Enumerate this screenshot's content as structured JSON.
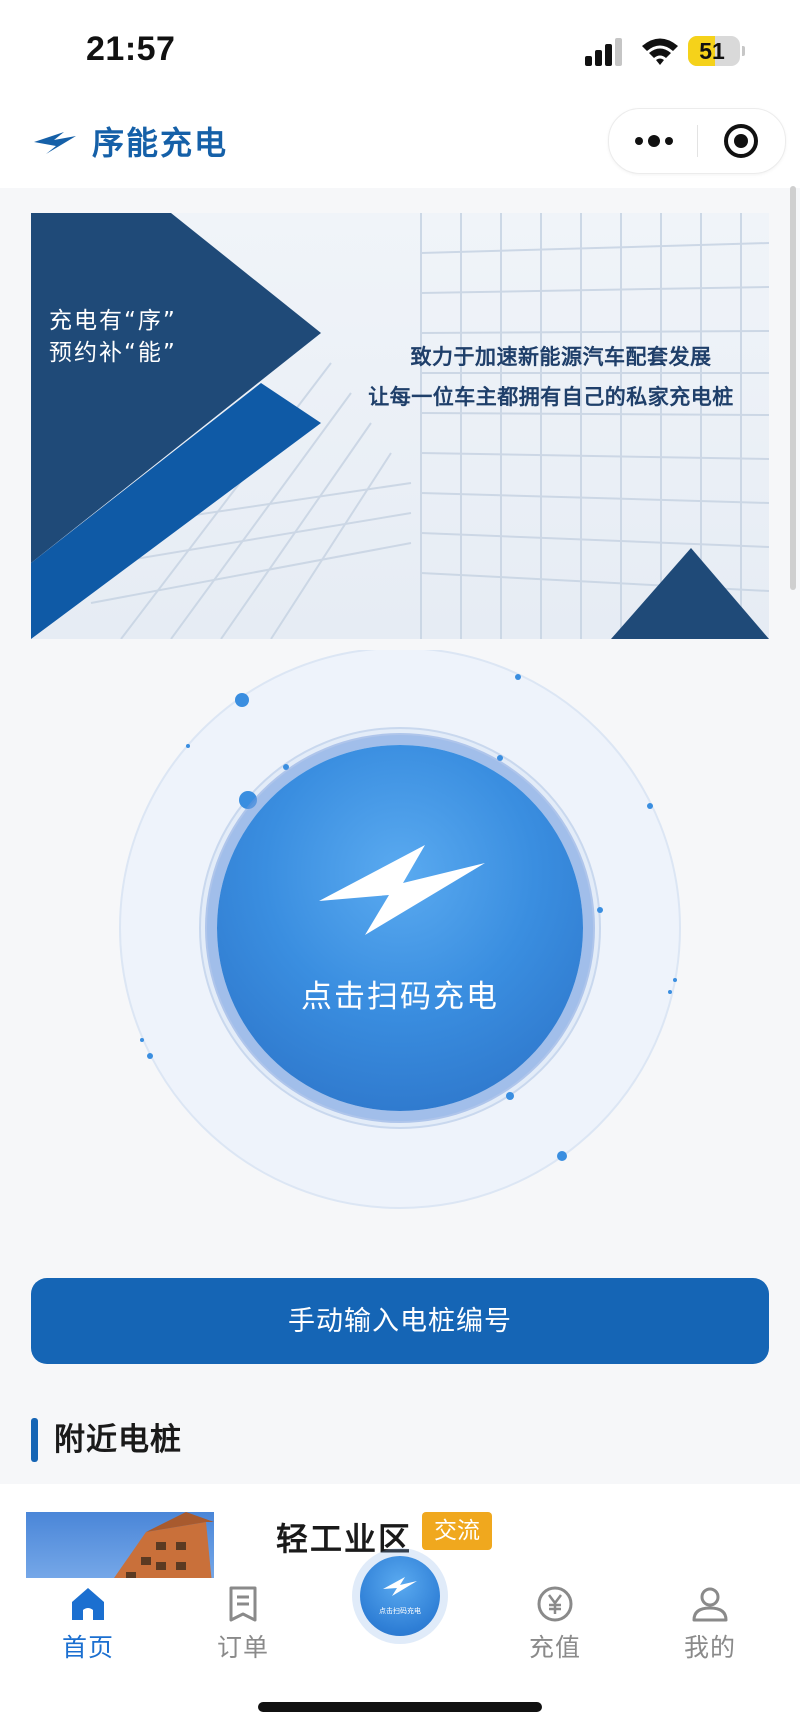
{
  "status_bar": {
    "time": "21:57",
    "battery": 51
  },
  "header": {
    "title": "序能充电"
  },
  "banner": {
    "slogan_line1": "充电有“序”",
    "slogan_line2": "预约补“能”",
    "tagline1": "致力于加速新能源汽车配套发展",
    "tagline2": "让每一位车主都拥有自己的私家充电桩"
  },
  "scan": {
    "label": "点击扫码充电"
  },
  "manual_input": {
    "label": "手动输入电桩编号"
  },
  "nearby": {
    "title": "附近电桩",
    "stations": [
      {
        "name": "轻工业区",
        "tag": "交流"
      }
    ]
  },
  "tabs": [
    {
      "label": "首页",
      "icon": "home-icon",
      "active": true
    },
    {
      "label": "订单",
      "icon": "orders-icon",
      "active": false
    },
    {
      "label": "充值",
      "icon": "yuan-icon",
      "active": false
    },
    {
      "label": "我的",
      "icon": "user-icon",
      "active": false
    }
  ],
  "tab_center": {
    "label": "点击扫码充电",
    "icon": "lightning-icon"
  },
  "colors": {
    "brand": "#1565b5",
    "accent": "#1b6fd0",
    "tag": "#f0a81e",
    "banner_dark": "#1e4d7e"
  }
}
